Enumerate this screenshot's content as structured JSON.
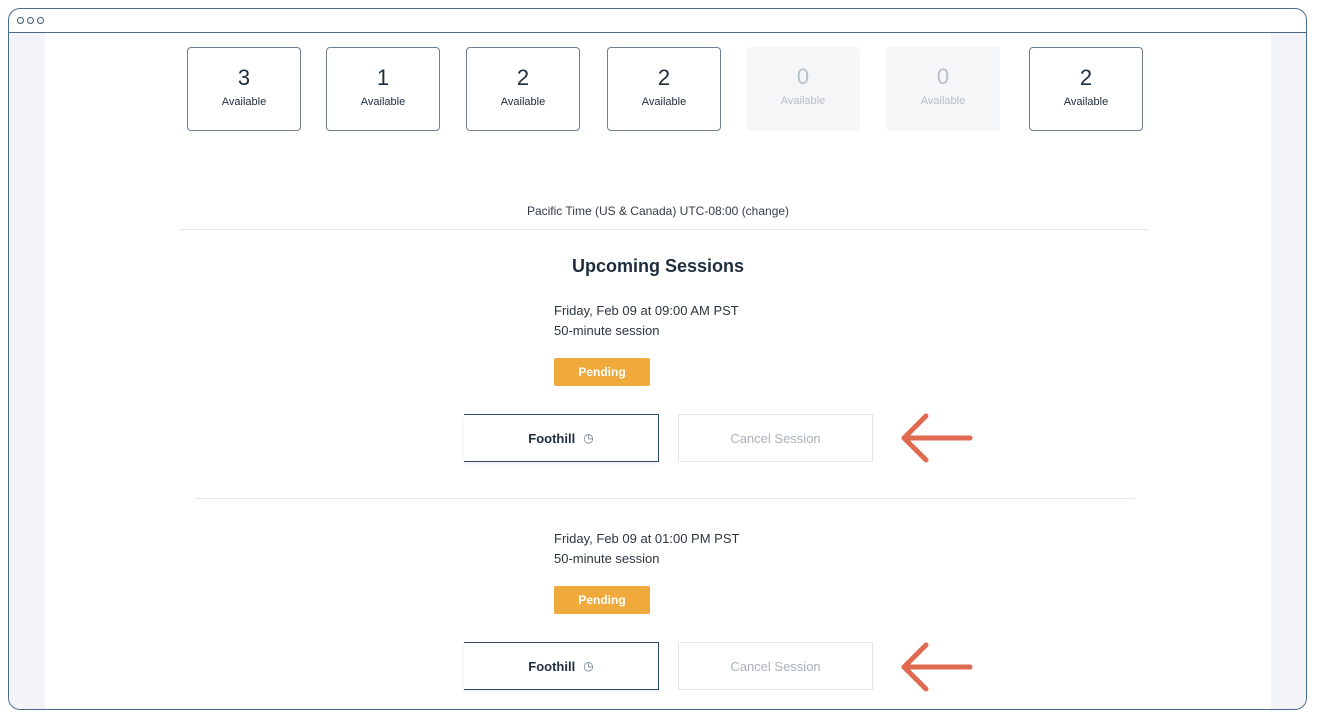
{
  "availability": [
    {
      "count": "3",
      "label": "Available",
      "disabled": false
    },
    {
      "count": "1",
      "label": "Available",
      "disabled": false
    },
    {
      "count": "2",
      "label": "Available",
      "disabled": false
    },
    {
      "count": "2",
      "label": "Available",
      "disabled": false
    },
    {
      "count": "0",
      "label": "Available",
      "disabled": true
    },
    {
      "count": "0",
      "label": "Available",
      "disabled": true
    },
    {
      "count": "2",
      "label": "Available",
      "disabled": false
    }
  ],
  "timezone": {
    "text": "Pacific Time (US & Canada) UTC-08:00",
    "change_label": "(change)"
  },
  "upcoming": {
    "title": "Upcoming Sessions",
    "sessions": [
      {
        "date": "Friday, Feb 09 at 09:00 AM PST",
        "length": "50-minute session",
        "status": "Pending",
        "college_label": "Foothill",
        "college_icon": "clock-icon",
        "cancel_label": "Cancel Session"
      },
      {
        "date": "Friday, Feb 09 at 01:00 PM PST",
        "length": "50-minute session",
        "status": "Pending",
        "college_label": "Foothill",
        "college_icon": "clock-icon",
        "cancel_label": "Cancel Session"
      }
    ]
  },
  "colors": {
    "badge": "#f0a93b",
    "arrow": "#e06a4f",
    "frame": "#4a6a8a"
  }
}
